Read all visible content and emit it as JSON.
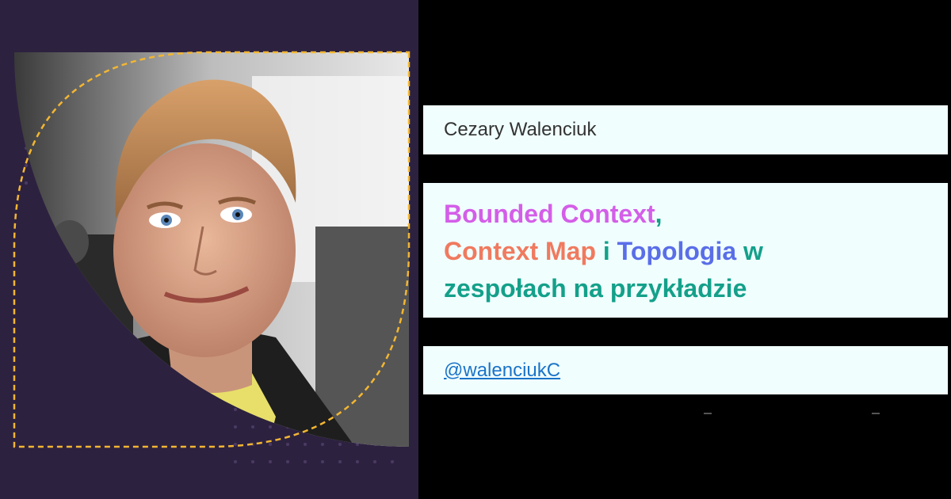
{
  "speaker": {
    "name": "Cezary Walenciuk",
    "handle": "@walenciukC"
  },
  "talk_title": {
    "part1": "Bounded Context",
    "comma": ",",
    "part2": "Context Map",
    "connector": " i ",
    "part3": "Topologia",
    "part4": " w",
    "part5": "zespołach na przykładzie"
  },
  "colors": {
    "left_background": "#2d2140",
    "accent_dashed_border": "#f2b632",
    "card_background": "#f0fffe",
    "pink": "#d45ee8",
    "teal": "#14a08a",
    "orange": "#f07a5f",
    "blue": "#5a6ee8",
    "link": "#1a73c9"
  },
  "icons": {
    "portrait": "speaker-photo"
  }
}
